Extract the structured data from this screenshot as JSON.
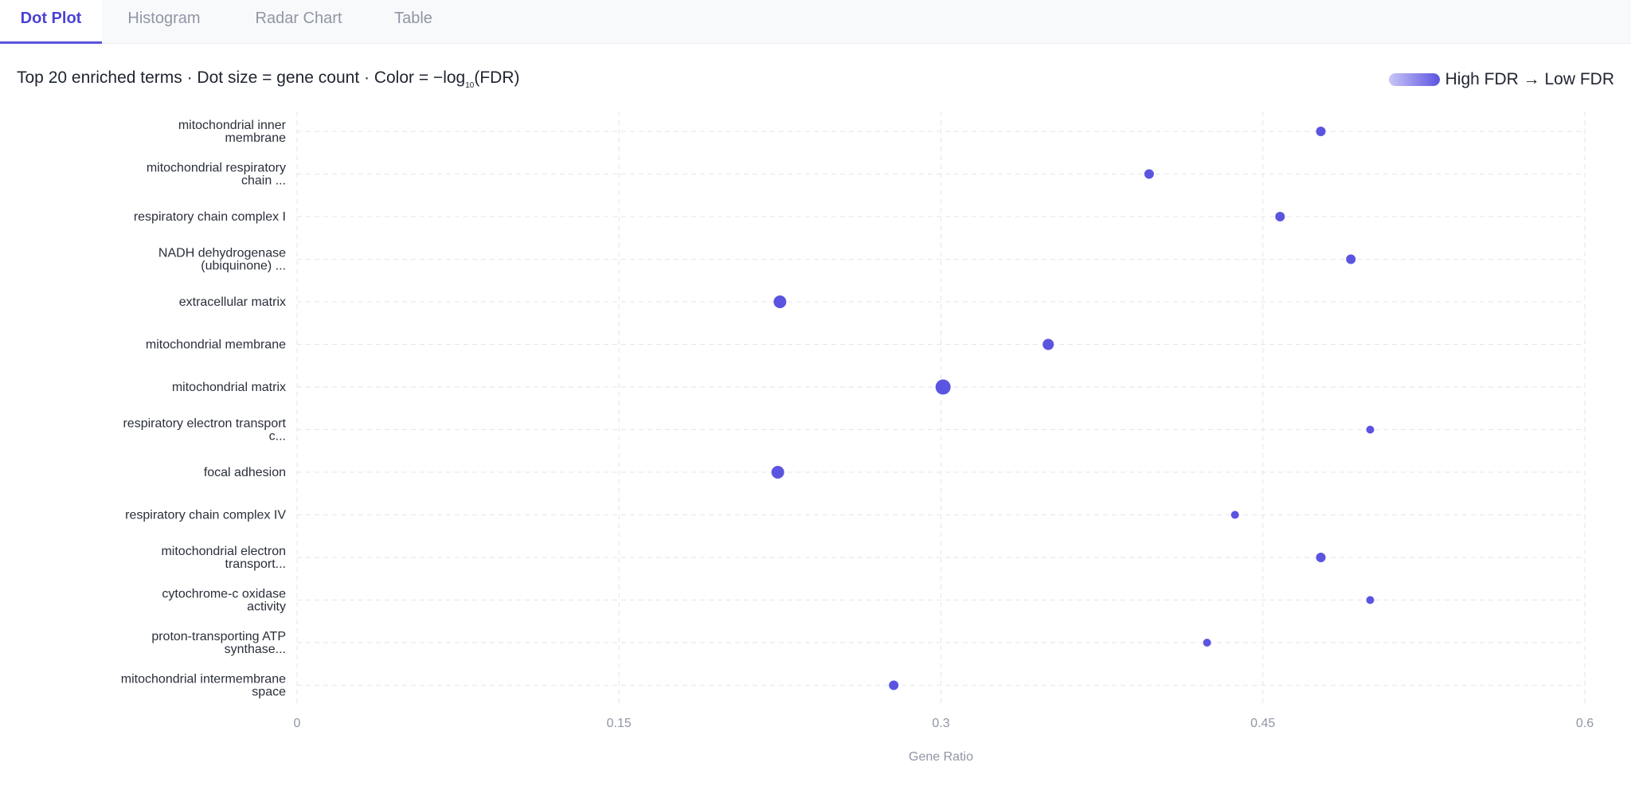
{
  "tabs": [
    {
      "label": "Dot Plot",
      "active": true
    },
    {
      "label": "Histogram",
      "active": false
    },
    {
      "label": "Radar Chart",
      "active": false
    },
    {
      "label": "Table",
      "active": false
    }
  ],
  "subtitle": {
    "prefix": "Top 20 enriched terms · Dot size = gene count · Color = −log",
    "subscript": "10",
    "suffix": "(FDR)"
  },
  "legend": {
    "label": "High FDR → Low FDR",
    "color_low": "#c9c6f5",
    "color_high": "#5b54e0"
  },
  "colors": {
    "accent": "#4a43d6",
    "dot": "#5b54e0",
    "grid": "#e4e6ec",
    "axis_text": "#9096a4",
    "label_text": "#2a2f3a"
  },
  "chart_data": {
    "type": "scatter",
    "xlabel": "Gene Ratio",
    "ylabel": "",
    "xlim": [
      0,
      0.6
    ],
    "xticks": [
      0,
      0.15,
      0.3,
      0.45,
      0.6
    ],
    "xtick_labels": [
      "0",
      "0.15",
      "0.3",
      "0.45",
      "0.6"
    ],
    "grid": true,
    "points": [
      {
        "term": [
          "mitochondrial inner",
          "membrane"
        ],
        "x": 0.477,
        "size": 1
      },
      {
        "term": [
          "mitochondrial respiratory",
          "chain ..."
        ],
        "x": 0.397,
        "size": 1
      },
      {
        "term": [
          "respiratory chain complex I"
        ],
        "x": 0.458,
        "size": 1
      },
      {
        "term": [
          "NADH dehydrogenase",
          "(ubiquinone) ..."
        ],
        "x": 0.491,
        "size": 1
      },
      {
        "term": [
          "extracellular matrix"
        ],
        "x": 0.225,
        "size": 3
      },
      {
        "term": [
          "mitochondrial membrane"
        ],
        "x": 0.35,
        "size": 2
      },
      {
        "term": [
          "mitochondrial matrix"
        ],
        "x": 0.301,
        "size": 4
      },
      {
        "term": [
          "respiratory electron transport",
          "c..."
        ],
        "x": 0.5,
        "size": 0
      },
      {
        "term": [
          "focal adhesion"
        ],
        "x": 0.224,
        "size": 3
      },
      {
        "term": [
          "respiratory chain complex IV"
        ],
        "x": 0.437,
        "size": 0
      },
      {
        "term": [
          "mitochondrial electron",
          "transport..."
        ],
        "x": 0.477,
        "size": 1
      },
      {
        "term": [
          "cytochrome-c oxidase",
          "activity"
        ],
        "x": 0.5,
        "size": 0
      },
      {
        "term": [
          "proton-transporting ATP",
          "synthase..."
        ],
        "x": 0.424,
        "size": 0
      },
      {
        "term": [
          "mitochondrial intermembrane",
          "space"
        ],
        "x": 0.278,
        "size": 1
      }
    ]
  }
}
